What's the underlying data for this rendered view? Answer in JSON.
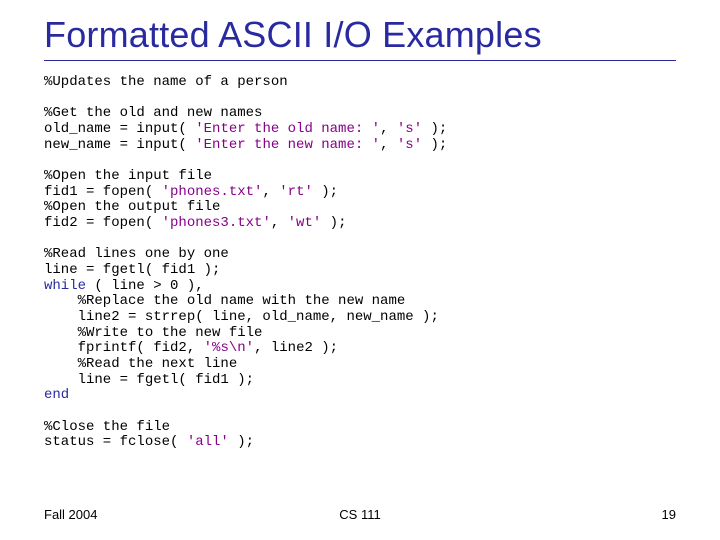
{
  "title": "Formatted ASCII I/O Examples",
  "code": {
    "c1": "%Updates the name of a person",
    "c2": "%Get the old and new names",
    "l3a": "old_name = input( ",
    "l3s": "'Enter the old name: '",
    "l3b": ", ",
    "l3s2": "'s'",
    "l3c": " );",
    "l4a": "new_name = input( ",
    "l4s": "'Enter the new name: '",
    "l4b": ", ",
    "l4s2": "'s'",
    "l4c": " );",
    "c5": "%Open the input file",
    "l6a": "fid1 = fopen( ",
    "l6s": "'phones.txt'",
    "l6b": ", ",
    "l6s2": "'rt'",
    "l6c": " );",
    "c7": "%Open the output file",
    "l8a": "fid2 = fopen( ",
    "l8s": "'phones3.txt'",
    "l8b": ", ",
    "l8s2": "'wt'",
    "l8c": " );",
    "c9": "%Read lines one by one",
    "l10": "line = fgetl( fid1 );",
    "l11kw": "while",
    "l11rest": " ( line > 0 ),",
    "c12": "    %Replace the old name with the new name",
    "l13": "    line2 = strrep( line, old_name, new_name );",
    "c14": "    %Write to the new file",
    "l15a": "    fprintf( fid2, ",
    "l15s": "'%s\\n'",
    "l15b": ", line2 );",
    "c16": "    %Read the next line",
    "l17": "    line = fgetl( fid1 );",
    "l18kw": "end",
    "c19": "%Close the file",
    "l20a": "status = fclose( ",
    "l20s": "'all'",
    "l20b": " );"
  },
  "footer": {
    "left": "Fall 2004",
    "center": "CS 111",
    "right": "19"
  }
}
